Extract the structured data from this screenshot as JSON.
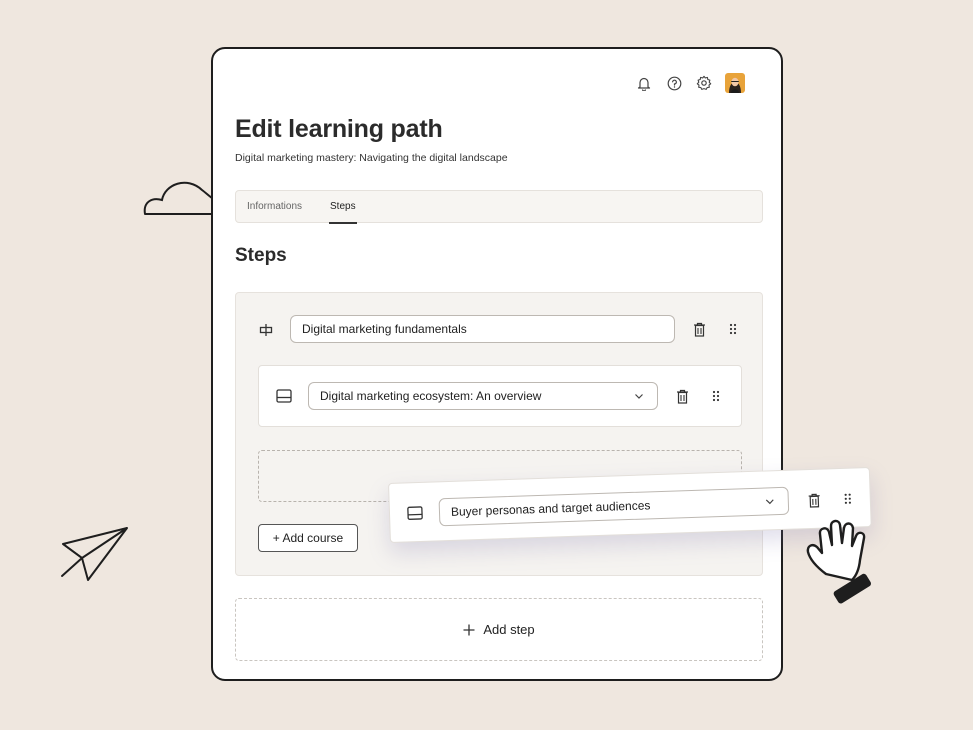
{
  "header": {
    "icons": [
      "bell-icon",
      "help-icon",
      "settings-icon"
    ],
    "avatar": "avatar"
  },
  "page": {
    "title": "Edit learning path",
    "subtitle": "Digital marketing mastery: Navigating the digital landscape"
  },
  "tabs": [
    {
      "label": "Informations",
      "active": false
    },
    {
      "label": "Steps",
      "active": true
    }
  ],
  "steps_section": {
    "title": "Steps",
    "step": {
      "value": "Digital marketing fundamentals",
      "icon": "step-icon",
      "courses": [
        {
          "value": "Digital marketing ecosystem: An overview",
          "icon": "course-icon"
        }
      ],
      "add_course_label": "+ Add course"
    },
    "add_step_label": "Add step"
  },
  "dragging_course": {
    "value": "Buyer personas and target audiences",
    "icon": "course-icon"
  },
  "colors": {
    "background": "#efe7df",
    "card_border": "#1e1e1e",
    "panel": "#f5f3f0"
  }
}
